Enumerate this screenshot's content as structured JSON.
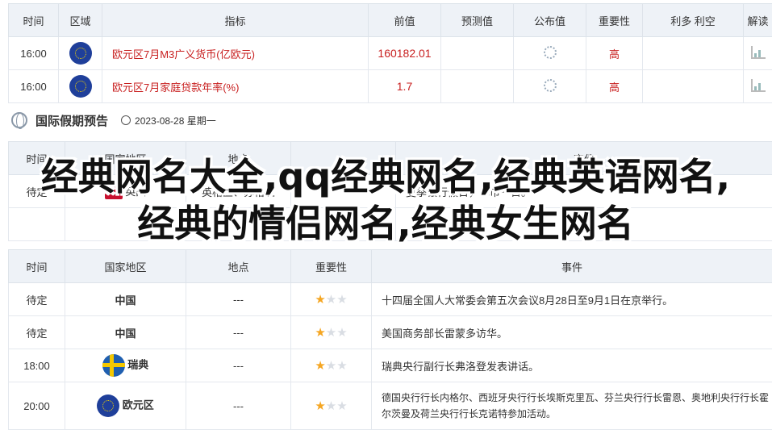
{
  "calendar": {
    "headers": [
      "时间",
      "区域",
      "指标",
      "前值",
      "预测值",
      "公布值",
      "重要性",
      "利多 利空",
      "解读"
    ],
    "rows": [
      {
        "time": "16:00",
        "region_icon": "eu-flag-icon",
        "indicator": "欧元区7月M3广义货币(亿欧元)",
        "prev": "160182.01",
        "importance": "高"
      },
      {
        "time": "16:00",
        "region_icon": "eu-flag-icon",
        "indicator": "欧元区7月家庭贷款年率(%)",
        "prev": "1.7",
        "importance": "高"
      }
    ]
  },
  "holiday": {
    "title": "国际假期预告",
    "date": "2023-08-28 星期一",
    "headers": [
      "时间",
      "国家地区",
      "地点",
      "",
      "事件"
    ],
    "partial_row": {
      "time": "待定",
      "country": "英国",
      "place": "英格兰、苏格兰",
      "event": "夏季银行假日，休市一日。"
    }
  },
  "events": {
    "headers": [
      "时间",
      "国家地区",
      "地点",
      "重要性",
      "事件"
    ],
    "rows": [
      {
        "time": "待定",
        "country": "中国",
        "place": "---",
        "stars": 1,
        "event": "十四届全国人大常委会第五次会议8月28日至9月1日在京举行。"
      },
      {
        "time": "待定",
        "country": "中国",
        "place": "---",
        "stars": 1,
        "event": "美国商务部长雷蒙多访华。"
      },
      {
        "time": "18:00",
        "country": "瑞典",
        "place": "---",
        "stars": 1,
        "event": "瑞典央行副行长弗洛登发表讲话。"
      },
      {
        "time": "20:00",
        "country": "欧元区",
        "place": "---",
        "stars": 1,
        "event": "德国央行行长内格尔、西班牙央行行长埃斯克里瓦、芬兰央行行长雷恩、奥地利央行行长霍尔茨曼及荷兰央行行长克诺特参加活动。"
      }
    ]
  },
  "overlay_title": "经典网名大全,qq经典网名,经典英语网名,经典的情侣网名,经典女生网名"
}
